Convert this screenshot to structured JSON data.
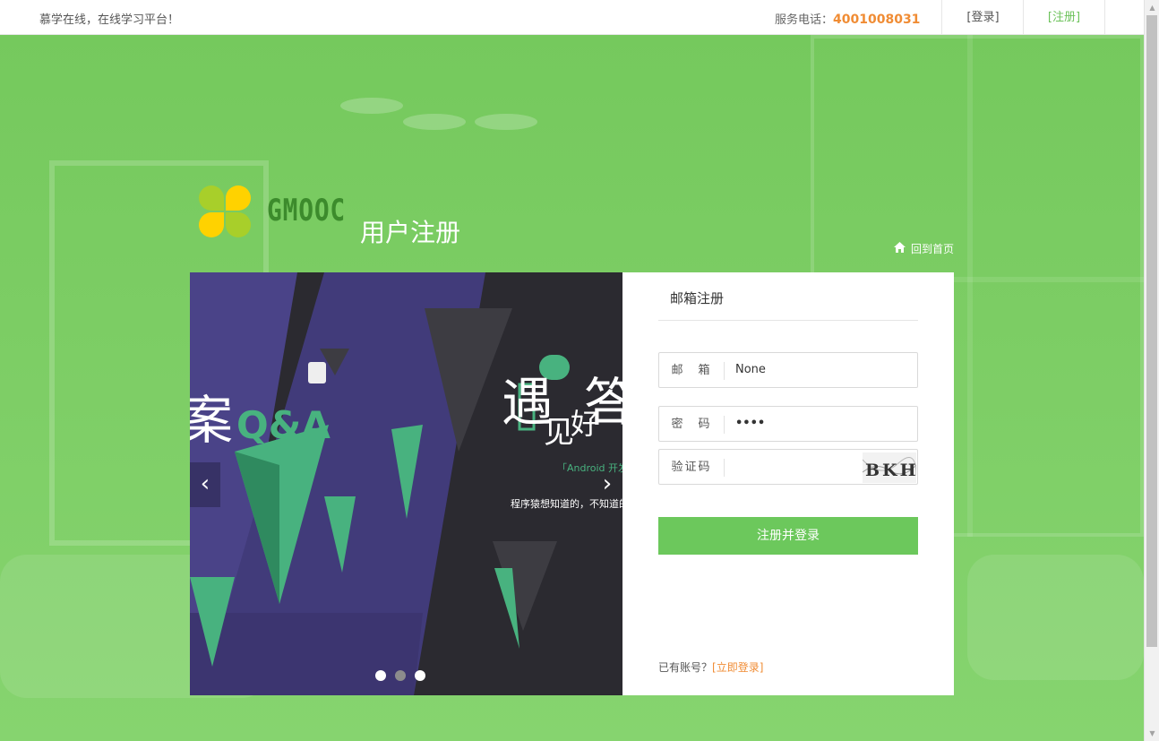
{
  "topbar": {
    "slogan": "慕学在线，在线学习平台！",
    "phone_label": "服务电话：",
    "phone_number": "4001008031",
    "login_label": "[登录]",
    "register_label": "[注册]"
  },
  "header": {
    "brand": "GMOOC",
    "title": "用户注册",
    "home_link": "回到首页"
  },
  "carousel": {
    "slide_text_main": "遇见好答案",
    "slide_text_sub": "「Android 开发问答专场」",
    "slide_text_small": "程序猿想知道的，不知道的，应该知道的，都在这",
    "slide_text_left": "案",
    "qa_label": "Q&A",
    "dots": [
      {
        "active": true
      },
      {
        "active": false
      },
      {
        "active": true
      }
    ]
  },
  "form": {
    "tab_label": "邮箱注册",
    "email_label": "邮　箱",
    "email_value": "None",
    "password_label": "密　码",
    "password_value": "••••",
    "captcha_label": "验证码",
    "captcha_text": "BKH",
    "submit_label": "注册并登录",
    "has_account_text": "已有账号？",
    "login_now_link": "[立即登录]"
  },
  "colors": {
    "accent_green": "#6cc85c",
    "accent_orange": "#f08c34",
    "background_green": "#7fcf67"
  }
}
